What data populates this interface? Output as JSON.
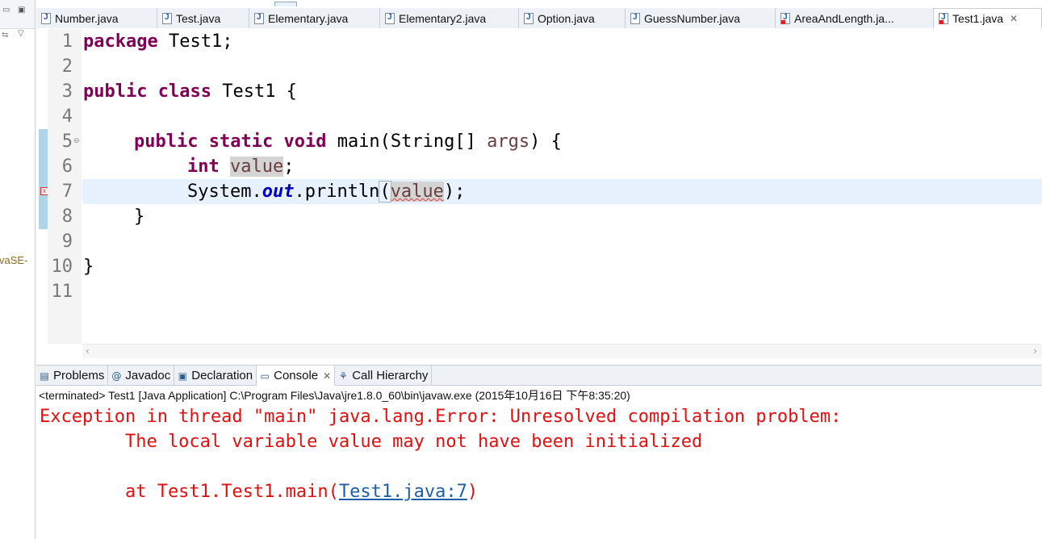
{
  "left_panel": {
    "jre_label": "vaSE-"
  },
  "editor_tabs": [
    {
      "label": "Number.java",
      "active": false,
      "error": false
    },
    {
      "label": "Test.java",
      "active": false,
      "error": false
    },
    {
      "label": "Elementary.java",
      "active": false,
      "error": false
    },
    {
      "label": "Elementary2.java",
      "active": false,
      "error": false
    },
    {
      "label": "Option.java",
      "active": false,
      "error": false
    },
    {
      "label": "GuessNumber.java",
      "active": false,
      "error": false
    },
    {
      "label": "AreaAndLength.ja...",
      "active": false,
      "error": true
    },
    {
      "label": "Test1.java",
      "active": true,
      "error": true
    }
  ],
  "editor": {
    "line_numbers": [
      "1",
      "2",
      "3",
      "4",
      "5",
      "6",
      "7",
      "8",
      "9",
      "10",
      "11"
    ],
    "code": {
      "l1_kw": "package",
      "l1_rest": " Test1;",
      "l3_kw1": "public",
      "l3_kw2": "class",
      "l3_rest": " Test1 {",
      "l5_kw1": "public",
      "l5_kw2": "static",
      "l5_kw3": "void",
      "l5_mid": " main(String[] ",
      "l5_param": "args",
      "l5_end": ") {",
      "l6_kw": "int",
      "l6_var": "value",
      "l6_end": ";",
      "l7_pre": "System.",
      "l7_field": "out",
      "l7_mid": ".println",
      "l7_open": "(",
      "l7_var": "value",
      "l7_close": ")",
      "l7_end": ";",
      "l8": "}",
      "l10": "}"
    },
    "current_line": 7,
    "error_line": 7
  },
  "panel_tabs": [
    {
      "label": "Problems",
      "icon": "problems-icon",
      "glyph": "▤",
      "active": false
    },
    {
      "label": "Javadoc",
      "icon": "javadoc-icon",
      "glyph": "@",
      "active": false
    },
    {
      "label": "Declaration",
      "icon": "declaration-icon",
      "glyph": "▣",
      "active": false
    },
    {
      "label": "Console",
      "icon": "console-icon",
      "glyph": "▭",
      "active": true,
      "closable": true
    },
    {
      "label": "Call Hierarchy",
      "icon": "call-hierarchy-icon",
      "glyph": "⚘",
      "active": false
    }
  ],
  "console": {
    "description": "<terminated> Test1 [Java Application] C:\\Program Files\\Java\\jre1.8.0_60\\bin\\javaw.exe (2015年10月16日 下午8:35:20)",
    "line1": "Exception in thread \"main\" java.lang.Error: Unresolved compilation problem: ",
    "line2": "        The local variable value may not have been initialized",
    "line4_pre": "        at Test1.Test1.main(",
    "line4_link": "Test1.java:7",
    "line4_post": ")"
  },
  "colors": {
    "keyword": "#7f0055",
    "static_field": "#0000c0",
    "local_var": "#6a3e3e",
    "console_error": "#e01010",
    "console_link": "#1f5fa8",
    "current_line": "#e8f2fe"
  }
}
